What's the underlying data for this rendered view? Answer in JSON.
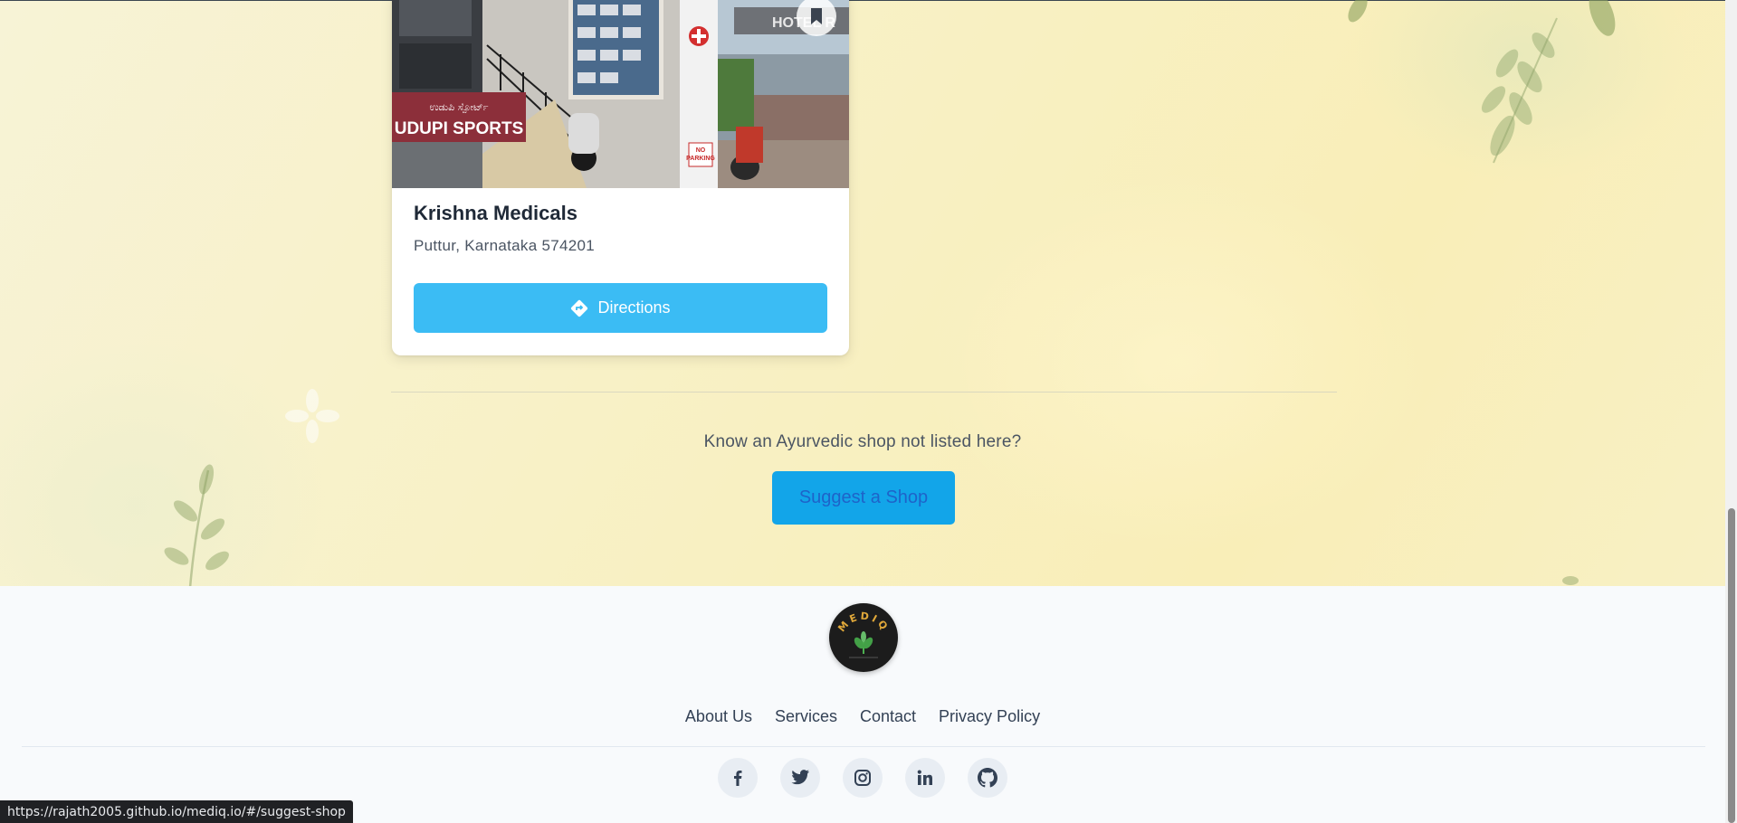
{
  "shop_card": {
    "name": "Krishna Medicals",
    "address": "Puttur, Karnataka 574201",
    "directions_label": "Directions",
    "photo_signs": {
      "sports_kannada": "ಉಡುಪಿ ಸ್ಪೋರ್ಟ್",
      "sports": "UDUPI SPORTS",
      "no_parking_1": "NO",
      "no_parking_2": "PARKING",
      "hotel": "HOTEL R"
    }
  },
  "suggest": {
    "prompt": "Know an Ayurvedic shop not listed here?",
    "button_label": "Suggest a Shop"
  },
  "footer": {
    "logo_text": "MEDIQ",
    "links": [
      "About Us",
      "Services",
      "Contact",
      "Privacy Policy"
    ],
    "socials": [
      "facebook-icon",
      "twitter-icon",
      "instagram-icon",
      "linkedin-icon",
      "github-icon"
    ]
  },
  "status_bar": {
    "url": "https://rajath2005.github.io/mediq.io/#/suggest-shop"
  },
  "colors": {
    "directions_bg": "#3bbcf4",
    "suggest_bg": "#12a5e9",
    "suggest_text": "#1e63c9",
    "card_title": "#1f2937",
    "footer_bg": "#f8fafc"
  }
}
